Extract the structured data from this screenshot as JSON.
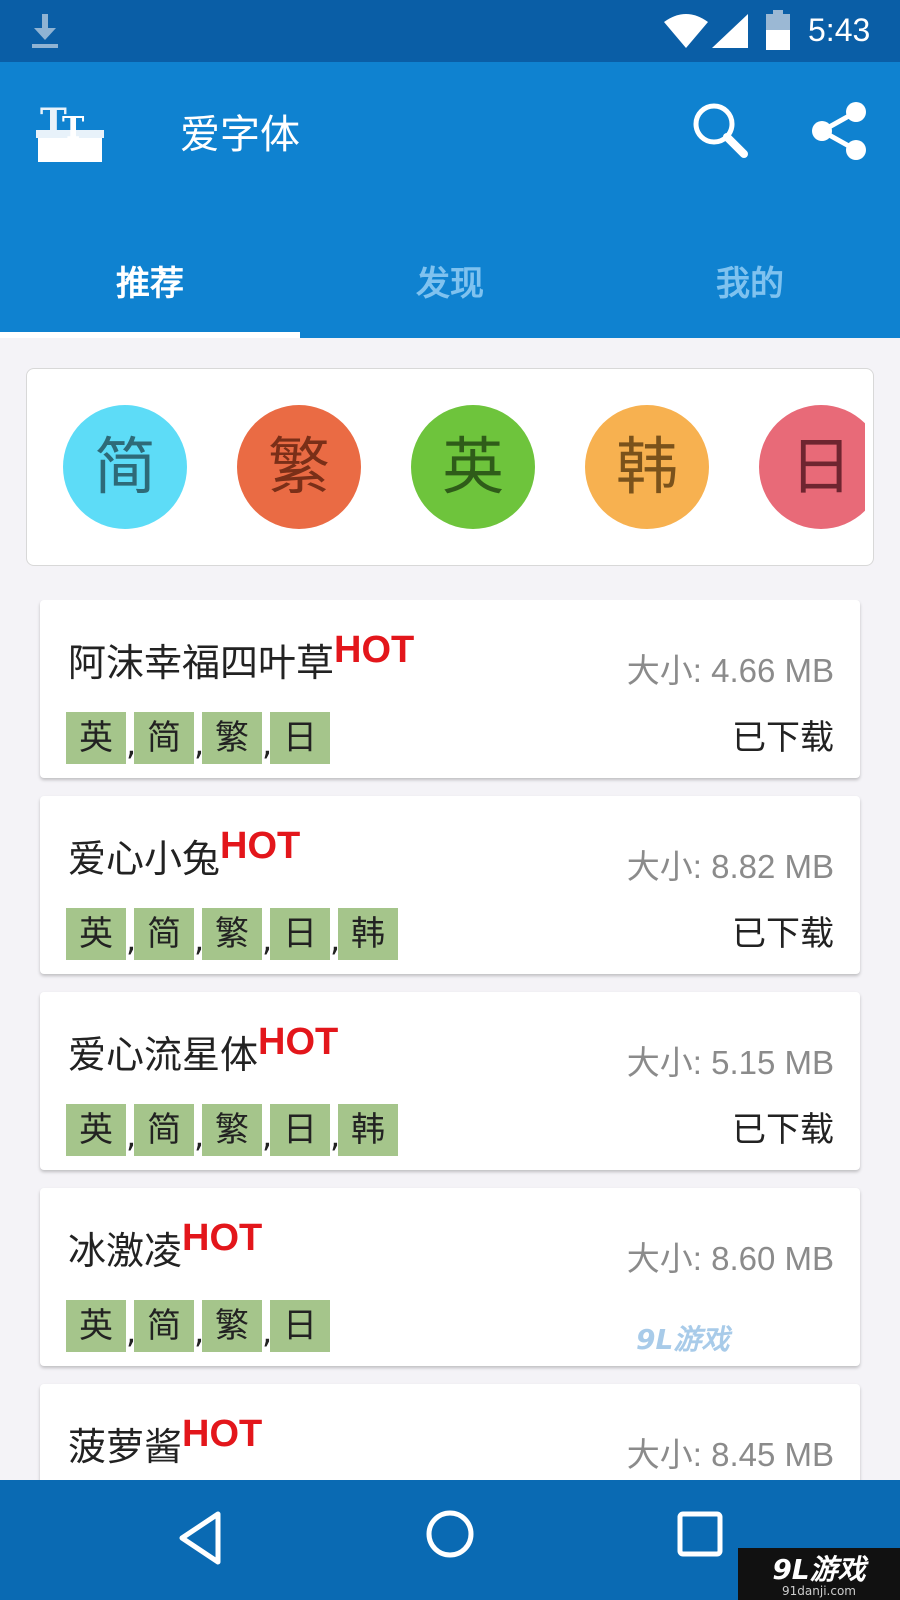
{
  "status_bar": {
    "time": "5:43"
  },
  "app_bar": {
    "title": "爱字体"
  },
  "tabs": [
    {
      "label": "推荐",
      "active": true
    },
    {
      "label": "发现",
      "active": false
    },
    {
      "label": "我的",
      "active": false
    }
  ],
  "categories": [
    {
      "label": "简",
      "color": "#5ddcf7",
      "text_color": "#2e6a78"
    },
    {
      "label": "繁",
      "color": "#ea6b44",
      "text_color": "#7a2f18"
    },
    {
      "label": "英",
      "color": "#6ec43c",
      "text_color": "#2f5c19"
    },
    {
      "label": "韩",
      "color": "#f7b150",
      "text_color": "#7a521b"
    },
    {
      "label": "日",
      "color": "#e86a78",
      "text_color": "#6e2530"
    }
  ],
  "hot_label": "HOT",
  "fonts": [
    {
      "name": "阿沫幸福四叶草",
      "size": "大小: 4.66 MB",
      "langs": [
        "英",
        "简",
        "繁",
        "日"
      ],
      "status": "已下载"
    },
    {
      "name": "爱心小兔",
      "size": "大小: 8.82 MB",
      "langs": [
        "英",
        "简",
        "繁",
        "日",
        "韩"
      ],
      "status": "已下载"
    },
    {
      "name": "爱心流星体",
      "size": "大小: 5.15 MB",
      "langs": [
        "英",
        "简",
        "繁",
        "日",
        "韩"
      ],
      "status": "已下载"
    },
    {
      "name": "冰激凌",
      "size": "大小: 8.60 MB",
      "langs": [
        "英",
        "简",
        "繁",
        "日"
      ],
      "status": ""
    },
    {
      "name": "菠萝酱",
      "size": "大小: 8.45 MB",
      "langs": [],
      "status": ""
    }
  ],
  "watermark": "9L游戏",
  "corner_mark": {
    "text": "9L游戏",
    "sub": "91danji.com"
  },
  "colors": {
    "status_bar": "#0a5ea6",
    "app_bar": "#0f82d0",
    "hot": "#e3161b",
    "lang_tag": "#a5c58b"
  }
}
